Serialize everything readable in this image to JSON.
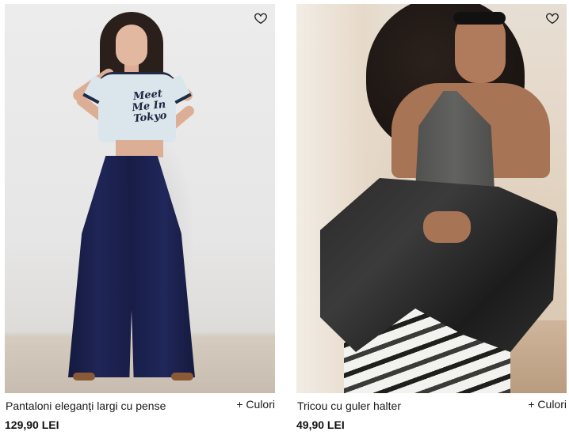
{
  "icons": {
    "wishlist": "heart-outline-icon"
  },
  "products": [
    {
      "name": "Pantaloni eleganți largi cu pense",
      "colors_label": "+ Culori",
      "price": "129,90 LEI",
      "tee_print": "Meet Me In Tokyo"
    },
    {
      "name": "Tricou cu guler halter",
      "colors_label": "+ Culori",
      "price": "49,90 LEI"
    }
  ]
}
